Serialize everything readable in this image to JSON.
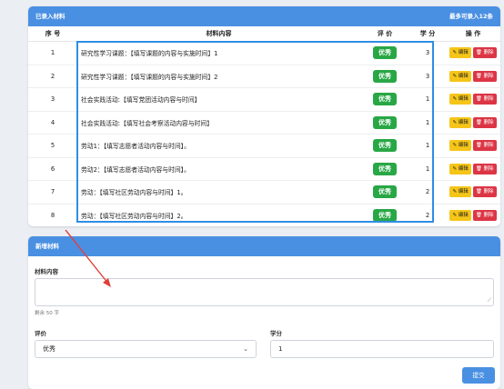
{
  "list": {
    "title": "已录入材料",
    "max_note": "最多可录入12条",
    "columns": [
      "序 号",
      "材料内容",
      "评 价",
      "学 分",
      "操 作"
    ],
    "rows": [
      {
        "num": "1",
        "content": "研究性学习课题：【填写课题的内容与实施时间】1",
        "rating": "优秀",
        "credit": "3"
      },
      {
        "num": "2",
        "content": "研究性学习课题：【填写课题的内容与实施时间】2",
        "rating": "优秀",
        "credit": "3"
      },
      {
        "num": "3",
        "content": "社会实践活动:【填写党团活动内容与时间】",
        "rating": "优秀",
        "credit": "1"
      },
      {
        "num": "4",
        "content": "社会实践活动:【填写社会考察活动内容与时间】",
        "rating": "优秀",
        "credit": "1"
      },
      {
        "num": "5",
        "content": "劳动1：【填写志愿者活动内容与时间】。",
        "rating": "优秀",
        "credit": "1"
      },
      {
        "num": "6",
        "content": "劳动2：【填写志愿者活动内容与时间】。",
        "rating": "优秀",
        "credit": "1"
      },
      {
        "num": "7",
        "content": "劳动：【填写社区劳动内容与时间】1。",
        "rating": "优秀",
        "credit": "2"
      },
      {
        "num": "8",
        "content": "劳动：【填写社区劳动内容与时间】2。",
        "rating": "优秀",
        "credit": "2"
      }
    ],
    "edit_label": "✎ 编辑",
    "delete_label": "🗑 删除"
  },
  "form": {
    "title": "新增材料",
    "content_label": "材料内容",
    "remaining_hint": "剩余 50 字",
    "rating_label": "评价",
    "rating_value": "优秀",
    "credit_label": "学分",
    "credit_value": "1",
    "submit_label": "提交"
  },
  "colors": {
    "header": "#4a90e2",
    "badge": "#28a745",
    "edit": "#f5c518",
    "delete": "#dc3545",
    "highlight": "#2f8de4",
    "arrow": "#e0403a"
  }
}
